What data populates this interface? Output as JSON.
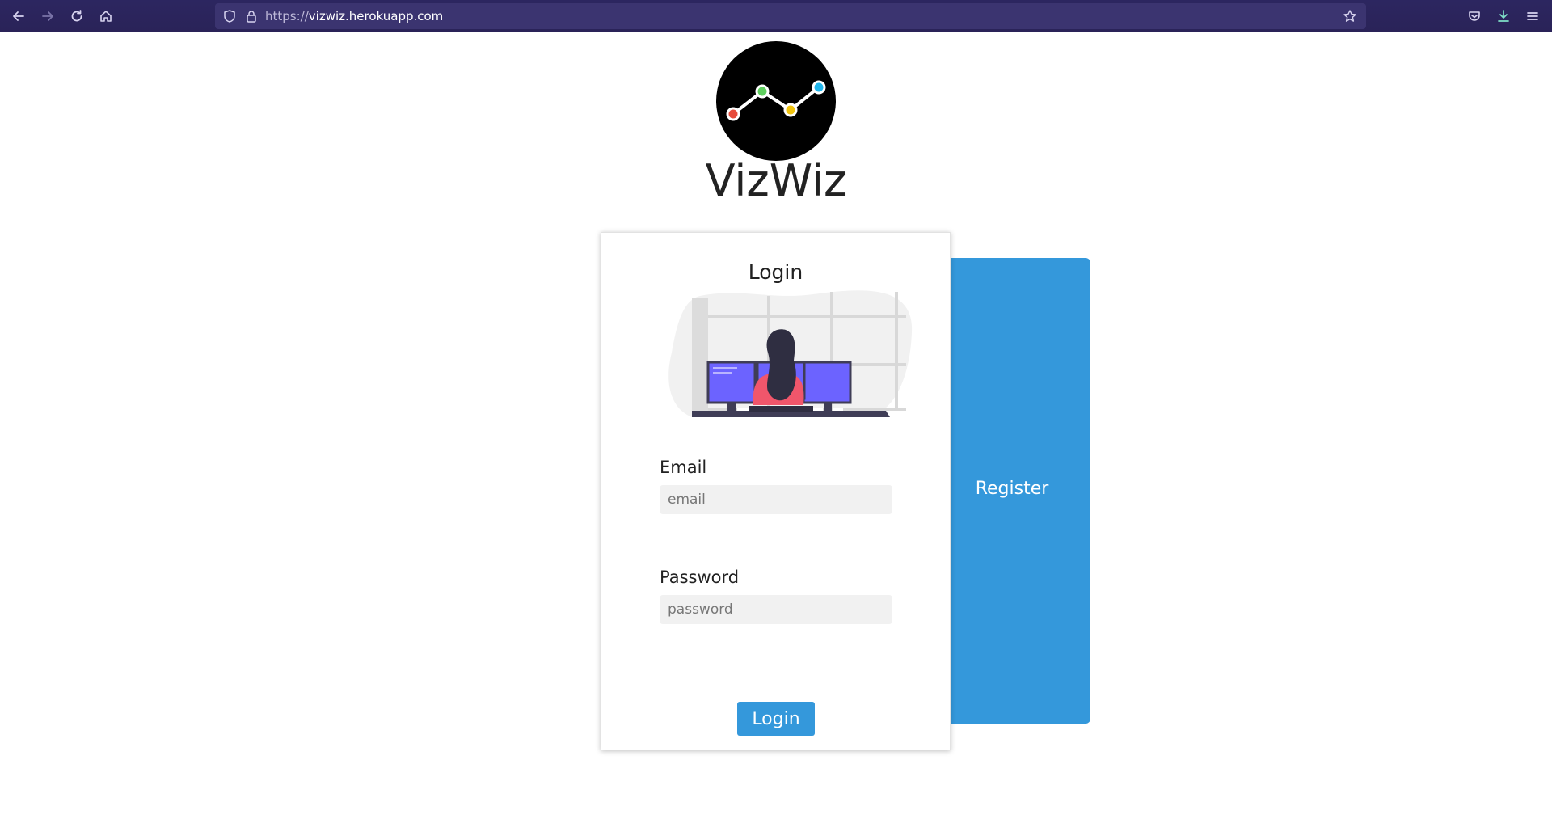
{
  "browser": {
    "url_scheme": "https://",
    "url_host": "vizwiz.herokuapp.com",
    "icons": [
      "back-icon",
      "forward-icon",
      "reload-icon",
      "home-icon",
      "shield-icon",
      "lock-icon",
      "star-icon",
      "pocket-icon",
      "download-icon",
      "menu-icon"
    ]
  },
  "brand": {
    "name": "VizWiz",
    "dot_colors": [
      "#e74c3c",
      "#5fcf5f",
      "#f1c40f",
      "#1fb5ec"
    ]
  },
  "register": {
    "label": "Register",
    "color": "#3498db"
  },
  "login": {
    "heading": "Login",
    "email_label": "Email",
    "email_placeholder": "email",
    "password_label": "Password",
    "password_placeholder": "password",
    "submit_label": "Login"
  }
}
